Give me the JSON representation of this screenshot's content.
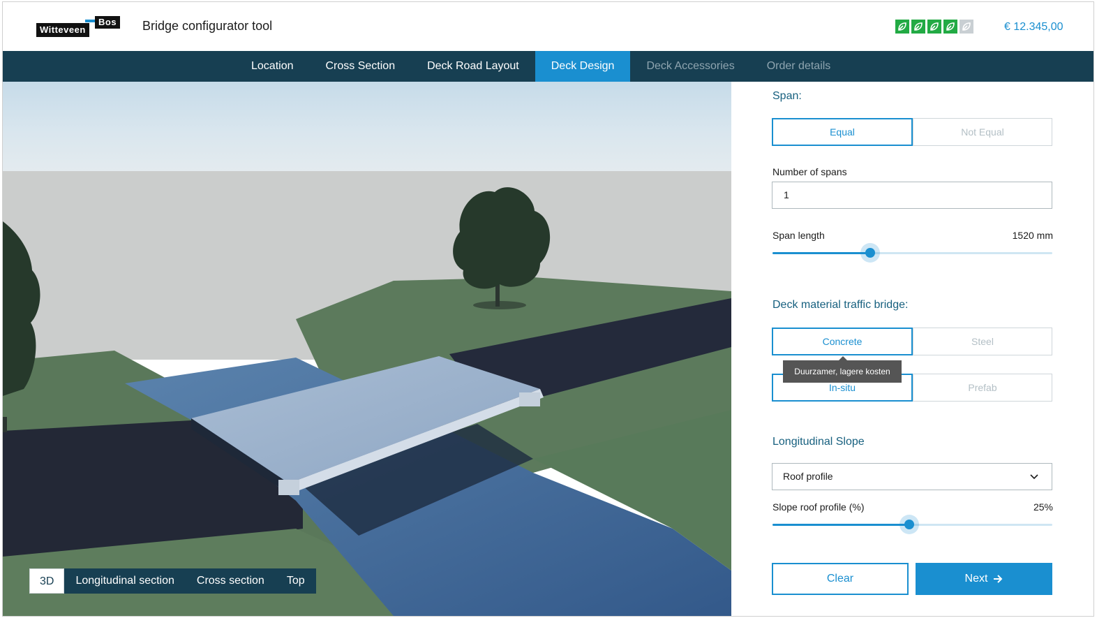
{
  "header": {
    "logo_top": "Bos",
    "logo_bottom": "Witteveen",
    "title": "Bridge configurator tool",
    "price": "€ 12.345,00",
    "sustainability_rating": {
      "value": 4,
      "max": 5,
      "icon": "leaf-icon",
      "on_color": "#22aa44",
      "off_color": "#c9cfd3"
    }
  },
  "nav": {
    "tabs": [
      {
        "label": "Location",
        "state": "done"
      },
      {
        "label": "Cross Section",
        "state": "done"
      },
      {
        "label": "Deck Road Layout",
        "state": "done"
      },
      {
        "label": "Deck Design",
        "state": "active"
      },
      {
        "label": "Deck Accessories",
        "state": "disabled"
      },
      {
        "label": "Order details",
        "state": "disabled"
      }
    ]
  },
  "viewport": {
    "views": [
      {
        "label": "3D",
        "active": true
      },
      {
        "label": "Longitudinal section",
        "active": false
      },
      {
        "label": "Cross section",
        "active": false
      },
      {
        "label": "Top",
        "active": false
      }
    ]
  },
  "panel": {
    "span": {
      "title": "Span:",
      "options": [
        "Equal",
        "Not Equal"
      ],
      "selected": "Equal"
    },
    "number_of_spans": {
      "label": "Number of spans",
      "value": "1"
    },
    "span_length": {
      "label": "Span length",
      "value_text": "1520 mm",
      "fraction": 0.35
    },
    "deck_material": {
      "title": "Deck material traffic bridge:",
      "options": [
        "Concrete",
        "Steel"
      ],
      "selected": "Concrete",
      "tooltip": "Duurzamer, lagere kosten",
      "sub_options": [
        "In-situ",
        "Prefab"
      ],
      "sub_selected": "In-situ"
    },
    "longitudinal_slope": {
      "title": "Longitudinal Slope",
      "selected": "Roof profile"
    },
    "slope_roof_profile": {
      "label": "Slope roof profile (%)",
      "value_text": "25%",
      "fraction": 0.49
    },
    "buttons": {
      "clear": "Clear",
      "next": "Next"
    }
  },
  "colors": {
    "primary": "#1a8fd0",
    "nav_bg": "#173f52",
    "title_text": "#17607f"
  }
}
